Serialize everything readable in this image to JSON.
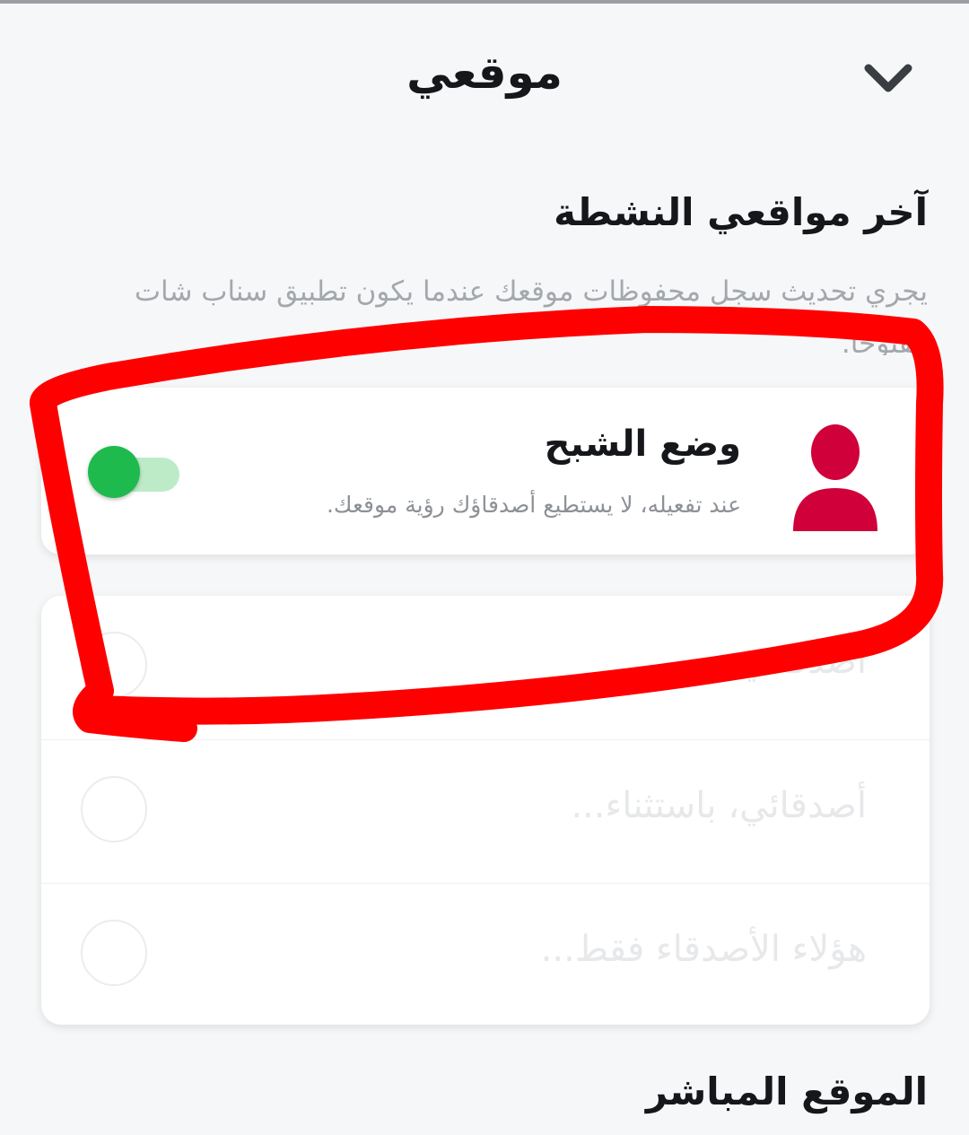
{
  "header": {
    "title": "موقعي",
    "collapse_icon": "chevron-down-icon"
  },
  "active_locations": {
    "title": "آخر مواقعي النشطة",
    "description": "يجري تحديث سجل محفوظات موقعك عندما يكون تطبيق سناب شات مفتوحاً."
  },
  "ghost_mode": {
    "title": "وضع الشبح",
    "description": "عند تفعيله، لا يستطيع أصدقاؤك رؤية موقعك.",
    "icon": "user-silhouette-icon",
    "enabled": true,
    "colors": {
      "icon": "#d0003a",
      "toggle_on": "#1fba4d",
      "toggle_track": "#bdebc8"
    }
  },
  "share_options": [
    {
      "label": "أصدقائي"
    },
    {
      "label": "أصدقائي، باستثناء..."
    },
    {
      "label": "هؤلاء الأصدقاء فقط..."
    }
  ],
  "live_location": {
    "title": "الموقع المباشر"
  },
  "annotation": {
    "color": "#ff0000"
  }
}
